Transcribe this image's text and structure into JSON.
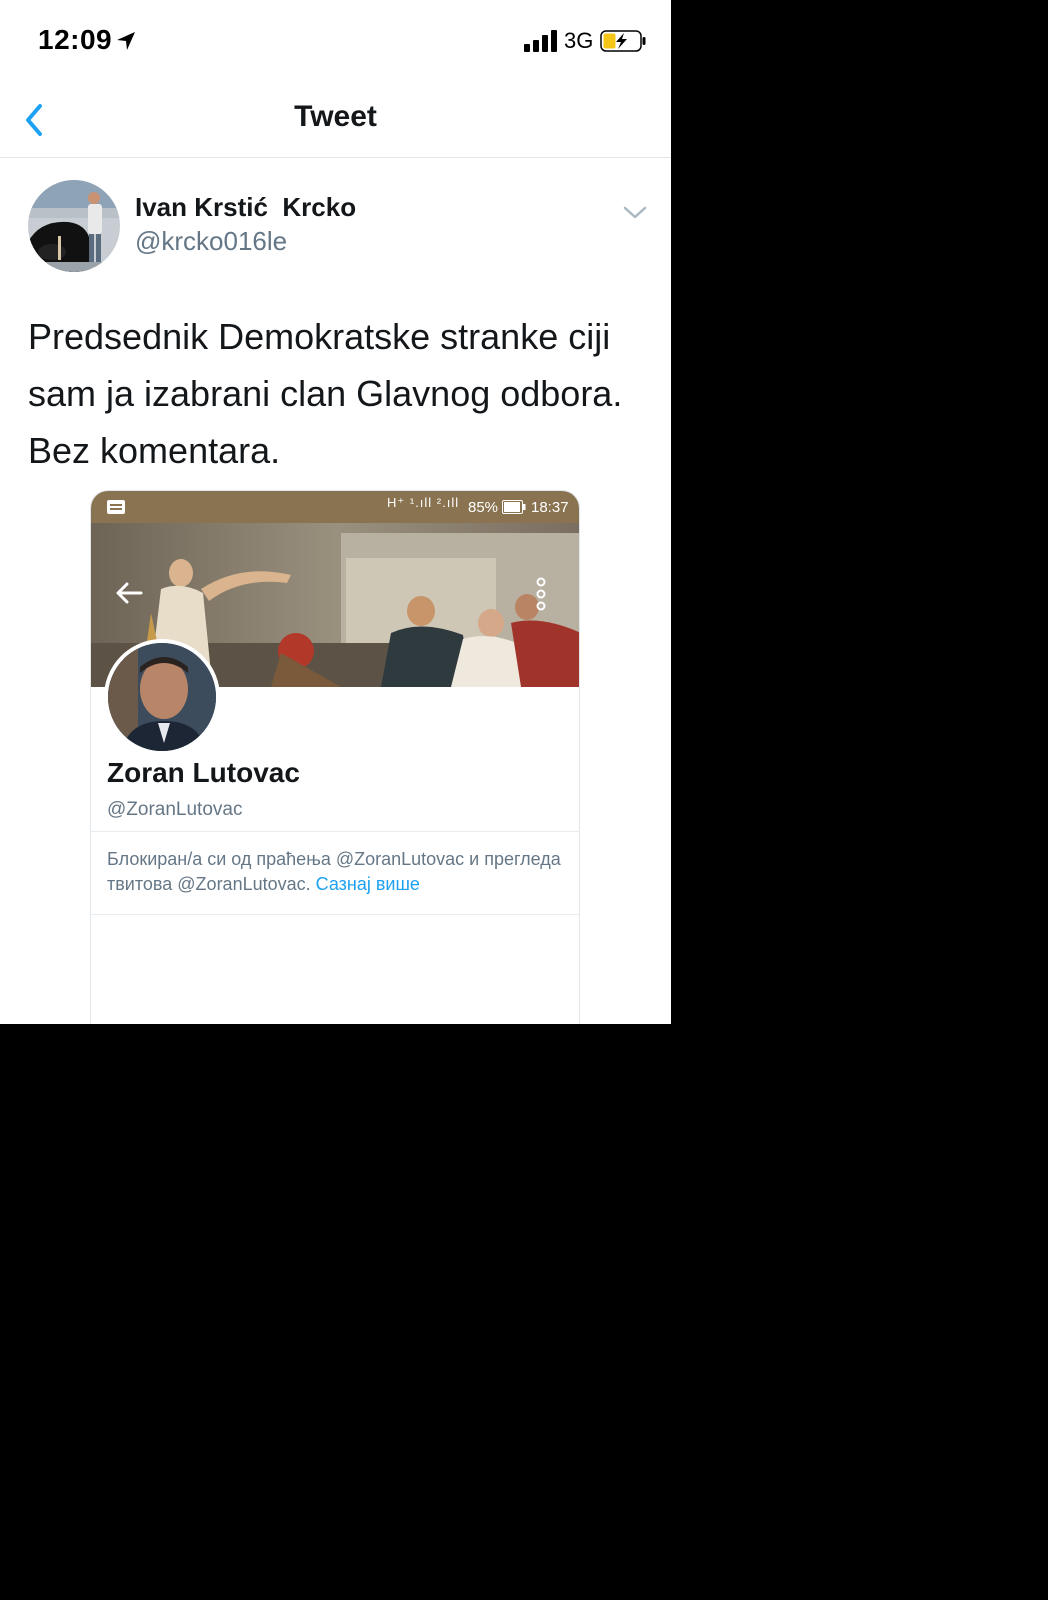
{
  "status_bar": {
    "time": "12:09",
    "network": "3G"
  },
  "nav": {
    "title": "Tweet"
  },
  "tweet": {
    "author_name": "Ivan Krstić  Krcko",
    "author_handle": "@krcko016le",
    "text_lines": [
      "Predsednik Demokratske stranke ciji",
      "sam ja izabrani clan Glavnog odbora.",
      "Bez komentara."
    ]
  },
  "media": {
    "status": {
      "signal_text": "H⁺ ¹.ıll ².ıll",
      "battery": "85%",
      "time": "18:37"
    },
    "profile_name": "Zoran Lutovac",
    "profile_handle": "@ZoranLutovac",
    "blocked_text": "Блокиран/а си од праћења @ZoranLutovac и прегледа твитова @ZoranLutovac.",
    "learn_more": "Сазнај више"
  },
  "colors": {
    "accent": "#1da1f2",
    "text": "#14171a",
    "muted": "#657786",
    "media_status": "#8a7350"
  },
  "icons": [
    "location-arrow-icon",
    "signal-icon",
    "battery-charging-icon",
    "back-chevron-icon",
    "chevron-down-icon",
    "back-arrow-icon",
    "more-vertical-icon",
    "notification-icon"
  ]
}
